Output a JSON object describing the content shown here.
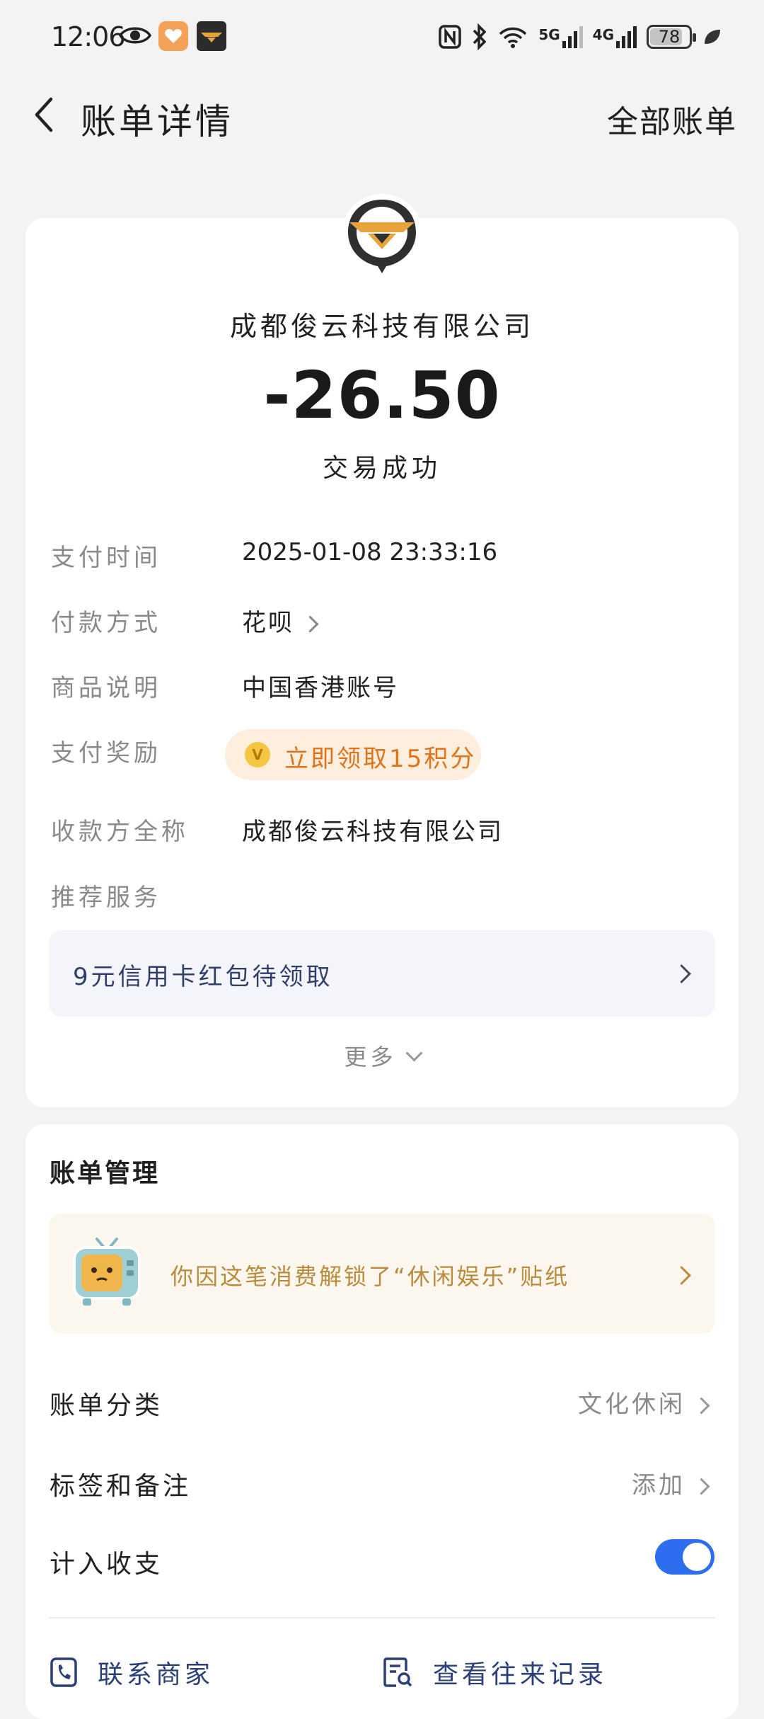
{
  "status_bar": {
    "time": "12:06",
    "signal_5g": "5G",
    "signal_4g": "4G",
    "battery": "78"
  },
  "nav": {
    "title": "账单详情",
    "all_bills": "全部账单"
  },
  "transaction": {
    "merchant": "成都俊云科技有限公司",
    "amount": "-26.50",
    "status": "交易成功"
  },
  "details": {
    "pay_time_label": "支付时间",
    "pay_time_value": "2025-01-08 23:33:16",
    "pay_method_label": "付款方式",
    "pay_method_value": "花呗",
    "product_label": "商品说明",
    "product_value": "中国香港账号",
    "reward_label": "支付奖励",
    "reward_value": "立即领取15积分",
    "payee_label": "收款方全称",
    "payee_value": "成都俊云科技有限公司",
    "recommend_label": "推荐服务",
    "promo_text": "9元信用卡红包待领取",
    "more_label": "更多"
  },
  "management": {
    "title": "账单管理",
    "sticker_text": "你因这笔消费解锁了“休闲娱乐”贴纸",
    "category_label": "账单分类",
    "category_value": "文化休闲",
    "tags_label": "标签和备注",
    "tags_value": "添加",
    "count_label": "计入收支",
    "count_enabled": true,
    "toggle_color": "#2d6ef0"
  },
  "actions": {
    "contact_merchant": "联系商家",
    "view_history": "查看往来记录"
  }
}
